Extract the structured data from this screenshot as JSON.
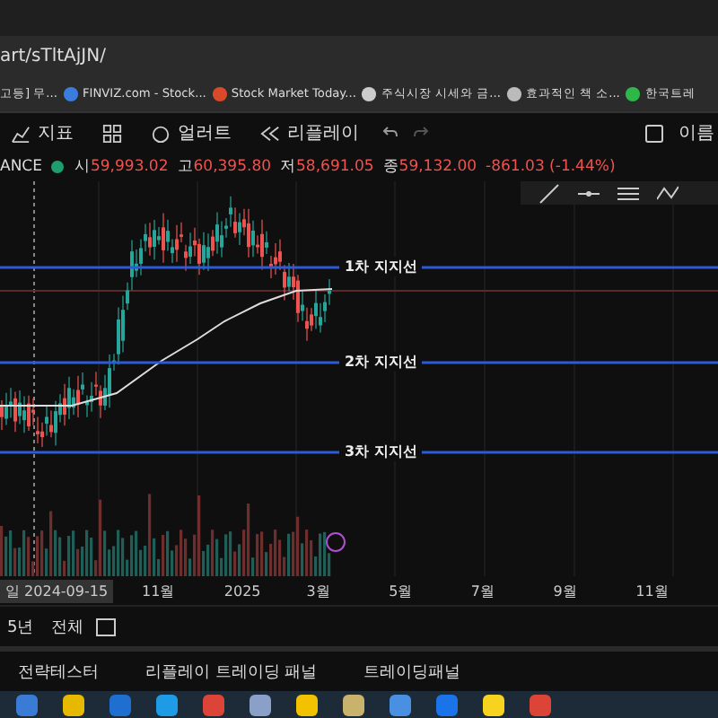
{
  "address_bar": {
    "url": "art/sTltAjJN/"
  },
  "bookmarks": [
    {
      "label": "고등] 무...",
      "kind": "page"
    },
    {
      "label": "FINVIZ.com - Stock...",
      "kind": "finviz"
    },
    {
      "label": "Stock Market Today...",
      "kind": "market"
    },
    {
      "label": "주식시장 시세와 금...",
      "kind": "chart"
    },
    {
      "label": "효과적인 책 소...",
      "kind": "book"
    },
    {
      "label": "한국트레",
      "kind": "leaf"
    }
  ],
  "toolbar": {
    "items": [
      {
        "label": "지표",
        "kind": "indicator"
      },
      {
        "kind": "grid"
      },
      {
        "label": "얼러트",
        "kind": "alert"
      },
      {
        "label": "리플레이",
        "kind": "replay"
      }
    ],
    "right_label": "이름"
  },
  "symbol": {
    "name": "ANCE",
    "ohlc": [
      {
        "label": "시",
        "value": "59,993.02"
      },
      {
        "label": "고",
        "value": "60,395.80"
      },
      {
        "label": "저",
        "value": "58,691.05"
      },
      {
        "label": "종",
        "value": "59,132.00"
      }
    ],
    "change": "-861.03 (-1.44%)"
  },
  "support_lines": [
    {
      "label": "1차 지지선"
    },
    {
      "label": "2차 지지선"
    },
    {
      "label": "3차 지지선"
    }
  ],
  "x_axis": {
    "cursor_label": "일 2024-09-15",
    "labels": [
      "11월",
      "2025",
      "3월",
      "5월",
      "7월",
      "9월",
      "11월"
    ]
  },
  "range_bar": [
    "5년",
    "전체"
  ],
  "bottom_tabs": [
    "전략테스터",
    "리플레이 트레이딩 패널",
    "트레이딩패널"
  ]
}
